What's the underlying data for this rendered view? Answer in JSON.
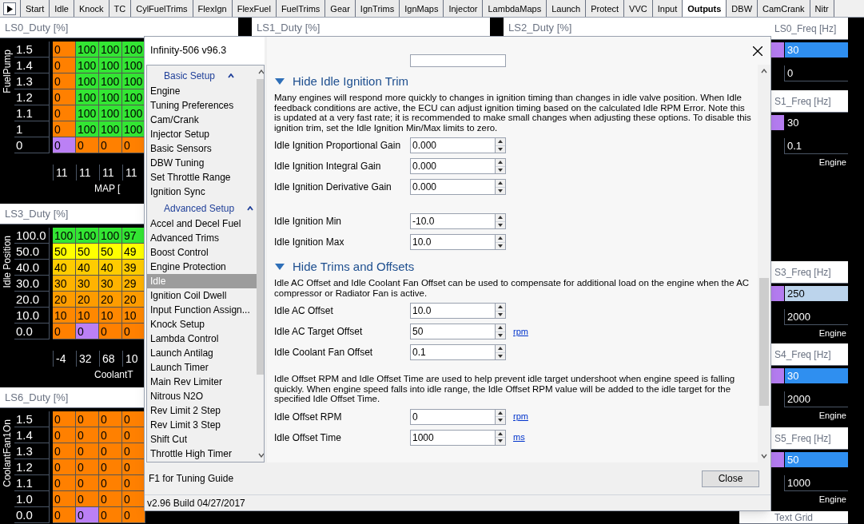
{
  "tabs": [
    {
      "label": "Start",
      "selected": false
    },
    {
      "label": "Idle",
      "selected": false
    },
    {
      "label": "Knock",
      "selected": false
    },
    {
      "label": "TC",
      "selected": false
    },
    {
      "label": "CylFuelTrims",
      "selected": false
    },
    {
      "label": "FlexIgn",
      "selected": false
    },
    {
      "label": "FlexFuel",
      "selected": false
    },
    {
      "label": "FuelTrims",
      "selected": false
    },
    {
      "label": "Gear",
      "selected": false
    },
    {
      "label": "IgnTrims",
      "selected": false
    },
    {
      "label": "IgnMaps",
      "selected": false
    },
    {
      "label": "Injector",
      "selected": false
    },
    {
      "label": "LambdaMaps",
      "selected": false
    },
    {
      "label": "Launch",
      "selected": false
    },
    {
      "label": "Protect",
      "selected": false
    },
    {
      "label": "VVC",
      "selected": false
    },
    {
      "label": "Input",
      "selected": false
    },
    {
      "label": "Outputs",
      "selected": true
    },
    {
      "label": "DBW",
      "selected": false
    },
    {
      "label": "CamCrank",
      "selected": false
    },
    {
      "label": "Nitr",
      "selected": false
    }
  ],
  "left_tables": [
    {
      "title": "LS0_Duty [%]",
      "y_axis": "FuelPump",
      "x_axis": "MAP [",
      "x_values": [
        "11",
        "11",
        "11",
        "11"
      ],
      "rows": [
        {
          "label": "1.5",
          "cells": [
            {
              "value": "0",
              "color": "#ff8000"
            },
            {
              "value": "100",
              "color": "#33e633"
            },
            {
              "value": "100",
              "color": "#33e633"
            },
            {
              "value": "100",
              "color": "#33e633"
            }
          ]
        },
        {
          "label": "1.4",
          "cells": [
            {
              "value": "0",
              "color": "#ff8000"
            },
            {
              "value": "100",
              "color": "#33e633"
            },
            {
              "value": "100",
              "color": "#33e633"
            },
            {
              "value": "100",
              "color": "#33e633"
            }
          ]
        },
        {
          "label": "1.3",
          "cells": [
            {
              "value": "0",
              "color": "#ff8000"
            },
            {
              "value": "100",
              "color": "#33e633"
            },
            {
              "value": "100",
              "color": "#33e633"
            },
            {
              "value": "100",
              "color": "#33e633"
            }
          ]
        },
        {
          "label": "1.2",
          "cells": [
            {
              "value": "0",
              "color": "#ff8000"
            },
            {
              "value": "100",
              "color": "#33e633"
            },
            {
              "value": "100",
              "color": "#33e633"
            },
            {
              "value": "100",
              "color": "#33e633"
            }
          ]
        },
        {
          "label": "1.1",
          "cells": [
            {
              "value": "0",
              "color": "#ff8000"
            },
            {
              "value": "100",
              "color": "#33e633"
            },
            {
              "value": "100",
              "color": "#33e633"
            },
            {
              "value": "100",
              "color": "#33e633"
            }
          ]
        },
        {
          "label": "1",
          "cells": [
            {
              "value": "0",
              "color": "#ff8000"
            },
            {
              "value": "100",
              "color": "#33e633"
            },
            {
              "value": "100",
              "color": "#33e633"
            },
            {
              "value": "100",
              "color": "#33e633"
            }
          ]
        },
        {
          "label": "0",
          "cells": [
            {
              "value": "0",
              "color": "#bb80f5"
            },
            {
              "value": "0",
              "color": "#ff8000"
            },
            {
              "value": "0",
              "color": "#ff8000"
            },
            {
              "value": "0",
              "color": "#ff8000"
            }
          ]
        }
      ]
    },
    {
      "title": "LS3_Duty [%]",
      "y_axis": "Idle Position",
      "x_axis": "CoolantT",
      "x_values": [
        "-4",
        "32",
        "68",
        "10"
      ],
      "rows": [
        {
          "label": "100.0",
          "cells": [
            {
              "value": "100",
              "color": "#33e633"
            },
            {
              "value": "100",
              "color": "#33e633"
            },
            {
              "value": "100",
              "color": "#33e633"
            },
            {
              "value": "97",
              "color": "#33e633"
            }
          ]
        },
        {
          "label": "50.0",
          "cells": [
            {
              "value": "50",
              "color": "#ffff00"
            },
            {
              "value": "50",
              "color": "#ffff00"
            },
            {
              "value": "50",
              "color": "#ffff00"
            },
            {
              "value": "49",
              "color": "#ffff00"
            }
          ]
        },
        {
          "label": "40.0",
          "cells": [
            {
              "value": "40",
              "color": "#ffcc00"
            },
            {
              "value": "40",
              "color": "#ffcc00"
            },
            {
              "value": "40",
              "color": "#ffcc00"
            },
            {
              "value": "39",
              "color": "#ffcc00"
            }
          ]
        },
        {
          "label": "30.0",
          "cells": [
            {
              "value": "30",
              "color": "#ffb300"
            },
            {
              "value": "30",
              "color": "#ffb300"
            },
            {
              "value": "30",
              "color": "#ffb300"
            },
            {
              "value": "29",
              "color": "#ffb300"
            }
          ]
        },
        {
          "label": "20.0",
          "cells": [
            {
              "value": "20",
              "color": "#ff9c00"
            },
            {
              "value": "20",
              "color": "#ff9c00"
            },
            {
              "value": "20",
              "color": "#ff9c00"
            },
            {
              "value": "20",
              "color": "#ff9c00"
            }
          ]
        },
        {
          "label": "10.0",
          "cells": [
            {
              "value": "10",
              "color": "#ff8800"
            },
            {
              "value": "10",
              "color": "#ff8800"
            },
            {
              "value": "10",
              "color": "#ff8800"
            },
            {
              "value": "10",
              "color": "#ff8800"
            }
          ]
        },
        {
          "label": "0.0",
          "cells": [
            {
              "value": "0",
              "color": "#ff8000"
            },
            {
              "value": "0",
              "color": "#bb80f5"
            },
            {
              "value": "0",
              "color": "#ff8000"
            },
            {
              "value": "0",
              "color": "#ff8000"
            }
          ]
        }
      ]
    },
    {
      "title": "LS6_Duty [%]",
      "y_axis": "CoolantFan1On",
      "rows": [
        {
          "label": "1.5",
          "cells": [
            {
              "value": "0",
              "color": "#ff8000"
            },
            {
              "value": "0",
              "color": "#ff8000"
            },
            {
              "value": "0",
              "color": "#ff8000"
            },
            {
              "value": "0",
              "color": "#ff8000"
            }
          ]
        },
        {
          "label": "1.4",
          "cells": [
            {
              "value": "0",
              "color": "#ff8000"
            },
            {
              "value": "0",
              "color": "#ff8000"
            },
            {
              "value": "0",
              "color": "#ff8000"
            },
            {
              "value": "0",
              "color": "#ff8000"
            }
          ]
        },
        {
          "label": "1.3",
          "cells": [
            {
              "value": "0",
              "color": "#ff8000"
            },
            {
              "value": "0",
              "color": "#ff8000"
            },
            {
              "value": "0",
              "color": "#ff8000"
            },
            {
              "value": "0",
              "color": "#ff8000"
            }
          ]
        },
        {
          "label": "1.2",
          "cells": [
            {
              "value": "0",
              "color": "#ff8000"
            },
            {
              "value": "0",
              "color": "#ff8000"
            },
            {
              "value": "0",
              "color": "#ff8000"
            },
            {
              "value": "0",
              "color": "#ff8000"
            }
          ]
        },
        {
          "label": "1.1",
          "cells": [
            {
              "value": "0",
              "color": "#ff8000"
            },
            {
              "value": "0",
              "color": "#ff8000"
            },
            {
              "value": "0",
              "color": "#ff8000"
            },
            {
              "value": "0",
              "color": "#ff8000"
            }
          ]
        },
        {
          "label": "1.0",
          "cells": [
            {
              "value": "0",
              "color": "#ff8000"
            },
            {
              "value": "0",
              "color": "#ff8000"
            },
            {
              "value": "0",
              "color": "#ff8000"
            },
            {
              "value": "0",
              "color": "#ff8000"
            }
          ]
        },
        {
          "label": "0.0",
          "cells": [
            {
              "value": "0",
              "color": "#ff8000"
            },
            {
              "value": "0",
              "color": "#bb80f5"
            },
            {
              "value": "0",
              "color": "#ff8000"
            },
            {
              "value": "0",
              "color": "#ff8000"
            }
          ]
        }
      ]
    }
  ],
  "middle_titles": [
    "LS1_Duty [%]",
    "LS2_Duty [%]"
  ],
  "right_panels": [
    {
      "title": "LS0_Freq [Hz]",
      "value": "30",
      "color": "#2f8ff0",
      "axis_value": "0"
    },
    {
      "title": "S1_Freq [Hz]",
      "value": "30",
      "color": "#000000",
      "axis_value": "0.1",
      "axis": "Engine"
    },
    {
      "title": "S3_Freq [Hz]",
      "value": "250",
      "color": "#bcd4ec",
      "axis_value": "2000",
      "axis": "Engine"
    },
    {
      "title": "S4_Freq [Hz]",
      "value": "30",
      "color": "#2f8ff0",
      "axis_value": "2000",
      "axis": "Engine"
    },
    {
      "title": "S5_Freq [Hz]",
      "value": "50",
      "color": "#2f8ff0",
      "axis_value": "1000",
      "axis": "Engine"
    },
    {
      "title": "Text Grid"
    }
  ],
  "dialog": {
    "title": "Infinity-506 v96.3",
    "nav": [
      {
        "kind": "header",
        "label": "Basic Setup",
        "expanded": true
      },
      {
        "kind": "item",
        "label": "Engine",
        "selected": false
      },
      {
        "kind": "item",
        "label": "Tuning Preferences",
        "selected": false
      },
      {
        "kind": "item",
        "label": "Cam/Crank",
        "selected": false
      },
      {
        "kind": "item",
        "label": "Injector Setup",
        "selected": false
      },
      {
        "kind": "item",
        "label": "Basic Sensors",
        "selected": false
      },
      {
        "kind": "item",
        "label": "DBW Tuning",
        "selected": false
      },
      {
        "kind": "item",
        "label": "Set Throttle Range",
        "selected": false
      },
      {
        "kind": "item",
        "label": "Ignition Sync",
        "selected": false
      },
      {
        "kind": "header",
        "label": "Advanced Setup",
        "expanded": true
      },
      {
        "kind": "item",
        "label": "Accel and Decel Fuel",
        "selected": false
      },
      {
        "kind": "item",
        "label": "Advanced Trims",
        "selected": false
      },
      {
        "kind": "item",
        "label": "Boost Control",
        "selected": false
      },
      {
        "kind": "item",
        "label": "Engine Protection",
        "selected": false
      },
      {
        "kind": "item",
        "label": "Idle",
        "selected": true
      },
      {
        "kind": "item",
        "label": "Ignition Coil Dwell",
        "selected": false
      },
      {
        "kind": "item",
        "label": "Input Function Assign...",
        "selected": false
      },
      {
        "kind": "item",
        "label": "Knock Setup",
        "selected": false
      },
      {
        "kind": "item",
        "label": "Lambda Control",
        "selected": false
      },
      {
        "kind": "item",
        "label": "Launch Antilag",
        "selected": false
      },
      {
        "kind": "item",
        "label": "Launch Timer",
        "selected": false
      },
      {
        "kind": "item",
        "label": "Main Rev Limiter",
        "selected": false
      },
      {
        "kind": "item",
        "label": "Nitrous N2O",
        "selected": false
      },
      {
        "kind": "item",
        "label": "Rev Limit 2 Step",
        "selected": false
      },
      {
        "kind": "item",
        "label": "Rev Limit 3 Step",
        "selected": false
      },
      {
        "kind": "item",
        "label": "Shift Cut",
        "selected": false
      },
      {
        "kind": "item",
        "label": "Throttle High Timer",
        "selected": false
      }
    ],
    "blocks": [
      {
        "kind": "heading",
        "title": "Hide Idle Ignition Trim",
        "expanded": true
      },
      {
        "kind": "paragraph",
        "text": "Many engines will respond more quickly to changes in ignition timing than changes in idle valve position. When Idle feedback conditions are active, the ECU can adjust ignition timing based on the calculated Idle RPM Error. Note this is updated at a very fast rate; it is recommended to make small changes when adjusting these options. To disable this ignition trim, set the Idle Ignition Min/Max limits to zero."
      },
      {
        "kind": "fields",
        "fields": [
          {
            "label": "Idle Ignition Proportional Gain",
            "value": "0.000"
          },
          {
            "label": "Idle Ignition Integral Gain",
            "value": "0.000"
          },
          {
            "label": "Idle Ignition Derivative Gain",
            "value": "0.000"
          }
        ]
      },
      {
        "kind": "fields",
        "fields": [
          {
            "label": "Idle Ignition Min",
            "value": "-10.0"
          },
          {
            "label": "Idle Ignition Max",
            "value": "10.0"
          }
        ]
      },
      {
        "kind": "heading",
        "title": "Hide Trims and Offsets",
        "expanded": true
      },
      {
        "kind": "paragraph",
        "text": "Idle AC Offset and Idle Coolant Fan Offset can be used to compensate for additional load on the engine when the AC compressor or Radiator Fan is active."
      },
      {
        "kind": "fields",
        "fields": [
          {
            "label": "Idle AC Offset",
            "value": "10.0"
          },
          {
            "label": "Idle AC Target Offset",
            "value": "50",
            "unit": "rpm"
          },
          {
            "label": "Idle Coolant Fan Offset",
            "value": "0.1"
          }
        ]
      },
      {
        "kind": "paragraph",
        "text": "Idle Offset RPM and Idle Offset Time are used to help prevent idle target undershoot when engine speed is falling quickly.  When engine speed falls into idle range, the Idle Offset RPM value will be added to the idle target for the specified Idle Offset Time."
      },
      {
        "kind": "fields",
        "fields": [
          {
            "label": "Idle Offset RPM",
            "value": "0",
            "unit": "rpm"
          },
          {
            "label": "Idle Offset Time",
            "value": "1000",
            "unit": "ms"
          }
        ]
      }
    ],
    "hint": "F1 for Tuning Guide",
    "close_button": "Close",
    "status": "v2.96 Build 04/27/2017"
  }
}
